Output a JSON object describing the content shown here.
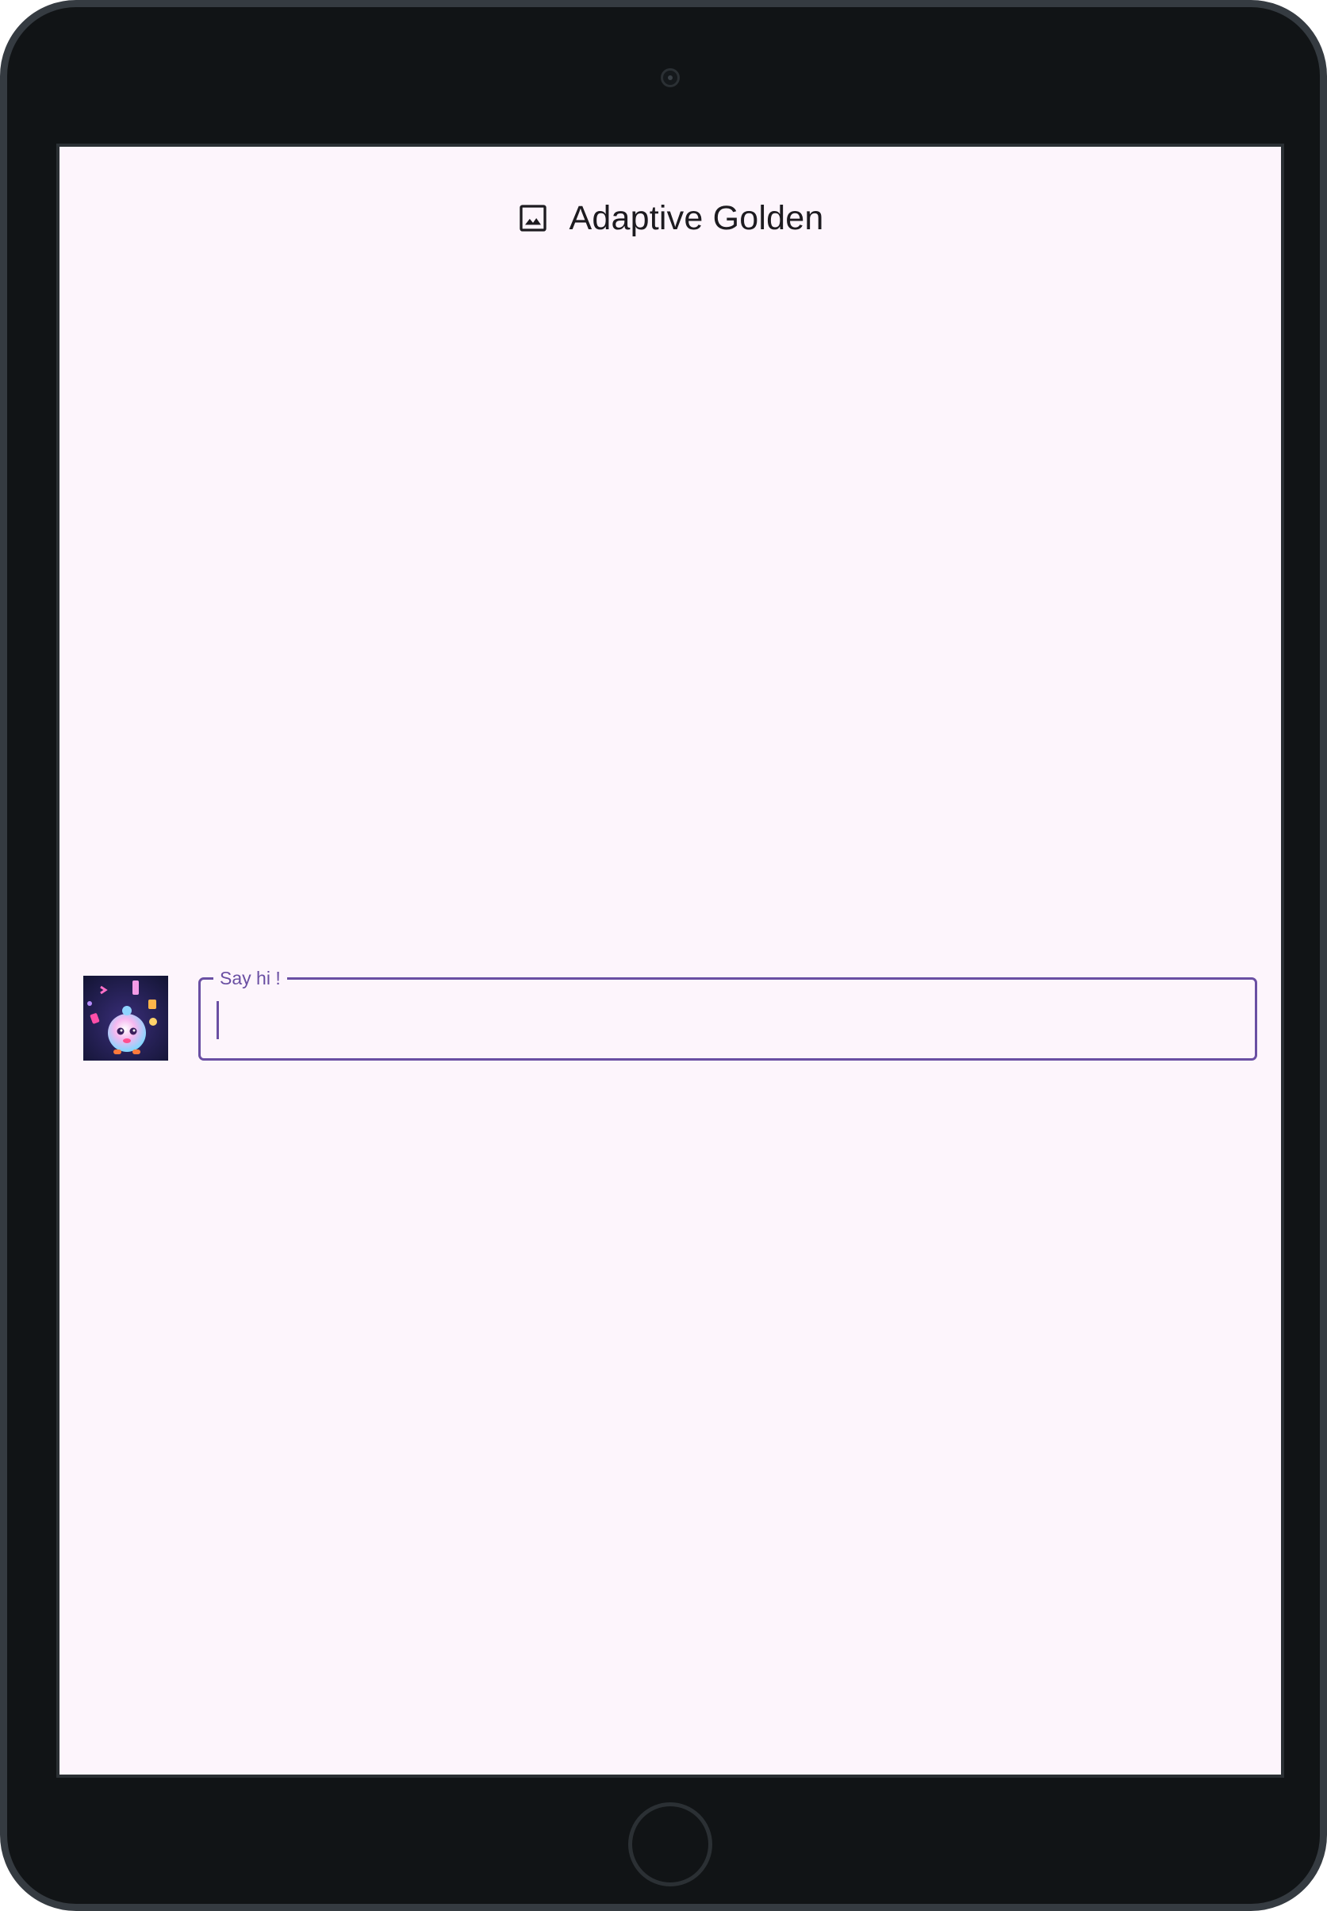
{
  "app": {
    "title": "Adaptive Golden",
    "title_icon": "image-icon"
  },
  "message_input": {
    "label": "Say hi !",
    "value": "",
    "avatar_icon": "avatar-image"
  },
  "colors": {
    "screen_background": "#fdf5fc",
    "accent": "#6a4fa3",
    "device_body": "#111416",
    "device_bezel": "#353b41"
  }
}
